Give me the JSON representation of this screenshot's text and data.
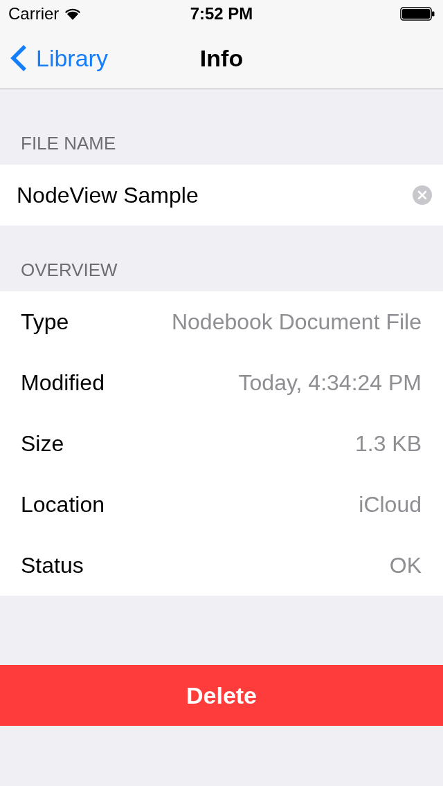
{
  "status_bar": {
    "carrier": "Carrier",
    "time": "7:52 PM"
  },
  "nav_bar": {
    "back": "Library",
    "title": "Info"
  },
  "file_name": {
    "header": "FILE NAME",
    "value": "NodeView Sample"
  },
  "overview": {
    "header": "OVERVIEW",
    "rows": [
      {
        "label": "Type",
        "value": "Nodebook Document File"
      },
      {
        "label": "Modified",
        "value": "Today, 4:34:24 PM"
      },
      {
        "label": "Size",
        "value": "1.3 KB"
      },
      {
        "label": "Location",
        "value": "iCloud"
      },
      {
        "label": "Status",
        "value": "OK"
      }
    ]
  },
  "delete_button": {
    "label": "Delete"
  }
}
